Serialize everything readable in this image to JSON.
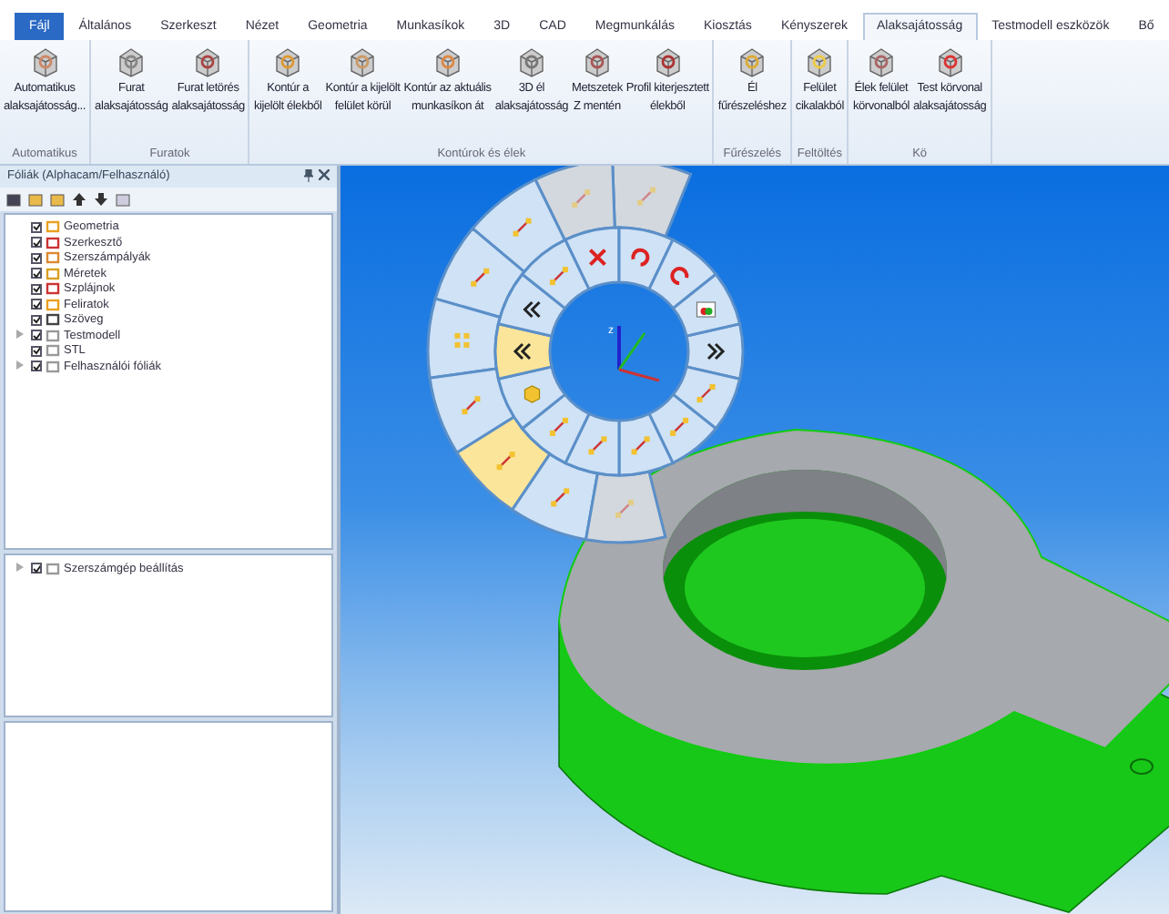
{
  "tabs": [
    {
      "label": "Fájl",
      "kind": "file",
      "selected": false
    },
    {
      "label": "Általános",
      "kind": "tab",
      "selected": false
    },
    {
      "label": "Szerkeszt",
      "kind": "tab",
      "selected": false
    },
    {
      "label": "Nézet",
      "kind": "tab",
      "selected": false
    },
    {
      "label": "Geometria",
      "kind": "tab",
      "selected": false
    },
    {
      "label": "Munkasíkok",
      "kind": "tab",
      "selected": false
    },
    {
      "label": "3D",
      "kind": "tab",
      "selected": false
    },
    {
      "label": "CAD",
      "kind": "tab",
      "selected": false
    },
    {
      "label": "Megmunkálás",
      "kind": "tab",
      "selected": false
    },
    {
      "label": "Kiosztás",
      "kind": "tab",
      "selected": false
    },
    {
      "label": "Kényszerek",
      "kind": "tab",
      "selected": false
    },
    {
      "label": "Alaksajátosság",
      "kind": "tab",
      "selected": true
    },
    {
      "label": "Testmodell eszközök",
      "kind": "tab",
      "selected": false
    },
    {
      "label": "Bő",
      "kind": "tab",
      "selected": false
    }
  ],
  "ribbon_groups": [
    {
      "label": "Automatikus",
      "buttons": [
        {
          "lines": [
            "Automatikus",
            "alaksajátosság..."
          ]
        }
      ]
    },
    {
      "label": "Furatok",
      "buttons": [
        {
          "lines": [
            "Furat",
            "alaksajátosság"
          ]
        },
        {
          "lines": [
            "Furat letörés",
            "alaksajátosság"
          ]
        }
      ]
    },
    {
      "label": "Kontúrok és élek",
      "buttons": [
        {
          "lines": [
            "Kontúr a",
            "kijelölt élekből"
          ]
        },
        {
          "lines": [
            "Kontúr a kijelölt",
            "felület körül"
          ]
        },
        {
          "lines": [
            "Kontúr az aktuális",
            "munkasíkon át"
          ]
        },
        {
          "lines": [
            "3D él",
            "alaksajátosság"
          ]
        },
        {
          "lines": [
            "Metszetek",
            "Z mentén"
          ]
        },
        {
          "lines": [
            "Profil kiterjesztett",
            "élekből"
          ]
        }
      ]
    },
    {
      "label": "Fűrészelés",
      "buttons": [
        {
          "lines": [
            "Él",
            "fűrészeléshez"
          ]
        }
      ]
    },
    {
      "label": "Feltöltés",
      "buttons": [
        {
          "lines": [
            "Felület",
            "cikalakból"
          ]
        }
      ]
    },
    {
      "label": "Kö",
      "buttons": [
        {
          "lines": [
            "Élek felület",
            "körvonalból"
          ]
        },
        {
          "lines": [
            "Test körvonal",
            "alaksajátosság"
          ]
        }
      ]
    }
  ],
  "panel": {
    "title": "Fóliák (Alphacam/Felhasználó)",
    "layers": [
      {
        "label": "Geometria",
        "checked": true,
        "expandable": false
      },
      {
        "label": "Szerkesztő",
        "checked": true,
        "expandable": false
      },
      {
        "label": "Szerszámpályák",
        "checked": true,
        "expandable": false
      },
      {
        "label": "Méretek",
        "checked": true,
        "expandable": false
      },
      {
        "label": "Szplájnok",
        "checked": true,
        "expandable": false
      },
      {
        "label": "Feliratok",
        "checked": true,
        "expandable": false
      },
      {
        "label": "Szöveg",
        "checked": true,
        "expandable": false
      },
      {
        "label": "Testmodell",
        "checked": true,
        "expandable": true
      },
      {
        "label": "STL",
        "checked": true,
        "expandable": false
      },
      {
        "label": "Felhasználói fóliák",
        "checked": true,
        "expandable": true
      }
    ],
    "machine_items": [
      {
        "label": "Szerszámgép beállítás",
        "checked": true,
        "expandable": true
      }
    ]
  },
  "radial_menu": {
    "outer_segments": [
      {
        "disabled": true,
        "highlighted": false
      },
      {
        "disabled": true,
        "highlighted": false
      },
      {
        "disabled": false,
        "highlighted": false
      },
      {
        "disabled": false,
        "highlighted": false
      },
      {
        "disabled": false,
        "highlighted": false
      },
      {
        "disabled": false,
        "highlighted": false
      },
      {
        "disabled": false,
        "highlighted": true
      },
      {
        "disabled": false,
        "highlighted": false
      },
      {
        "disabled": true,
        "highlighted": false
      }
    ],
    "inner_segments": [
      {
        "highlighted": false
      },
      {
        "highlighted": false
      },
      {
        "highlighted": false
      },
      {
        "highlighted": false
      },
      {
        "highlighted": false
      },
      {
        "highlighted": false
      },
      {
        "highlighted": false
      },
      {
        "highlighted": true
      },
      {
        "highlighted": false
      },
      {
        "highlighted": false
      },
      {
        "highlighted": false
      },
      {
        "highlighted": false
      },
      {
        "highlighted": false
      },
      {
        "highlighted": false
      }
    ],
    "axis_label": "z"
  }
}
